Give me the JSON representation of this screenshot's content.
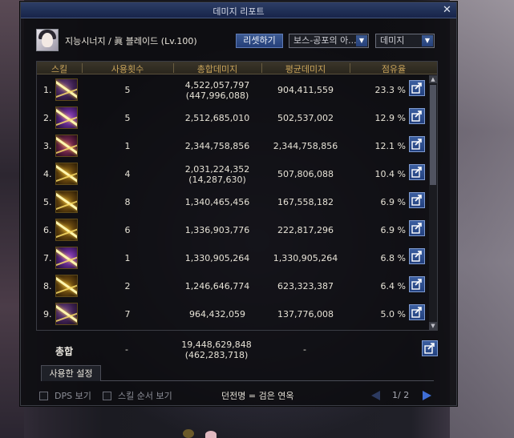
{
  "window": {
    "title": "데미지 리포트",
    "close_label": "✕"
  },
  "character": {
    "name": "지능시너지 / 眞 블레이드 (Lv.100)"
  },
  "controls": {
    "reset_label": "리셋하기",
    "boss_select": "보스-공포의 아...",
    "type_select": "데미지"
  },
  "table": {
    "headers": [
      "스킬",
      "사용횟수",
      "총합데미지",
      "평균데미지",
      "점유율"
    ],
    "rows": [
      {
        "rank": "1.",
        "count": "5",
        "total": "4,522,057,797",
        "total_sub": "(447,996,088)",
        "avg": "904,411,559",
        "share": "23.3 %"
      },
      {
        "rank": "2.",
        "count": "5",
        "total": "2,512,685,010",
        "total_sub": "",
        "avg": "502,537,002",
        "share": "12.9 %"
      },
      {
        "rank": "3.",
        "count": "1",
        "total": "2,344,758,856",
        "total_sub": "",
        "avg": "2,344,758,856",
        "share": "12.1 %"
      },
      {
        "rank": "4.",
        "count": "4",
        "total": "2,031,224,352",
        "total_sub": "(14,287,630)",
        "avg": "507,806,088",
        "share": "10.4 %"
      },
      {
        "rank": "5.",
        "count": "8",
        "total": "1,340,465,456",
        "total_sub": "",
        "avg": "167,558,182",
        "share": "6.9 %"
      },
      {
        "rank": "6.",
        "count": "6",
        "total": "1,336,903,776",
        "total_sub": "",
        "avg": "222,817,296",
        "share": "6.9 %"
      },
      {
        "rank": "7.",
        "count": "1",
        "total": "1,330,905,264",
        "total_sub": "",
        "avg": "1,330,905,264",
        "share": "6.8 %"
      },
      {
        "rank": "8.",
        "count": "2",
        "total": "1,246,646,774",
        "total_sub": "",
        "avg": "623,323,387",
        "share": "6.4 %"
      },
      {
        "rank": "9.",
        "count": "7",
        "total": "964,432,059",
        "total_sub": "",
        "avg": "137,776,008",
        "share": "5.0 %"
      }
    ]
  },
  "totals": {
    "label": "총합",
    "count": "-",
    "total": "19,448,629,848",
    "total_sub": "(462,283,718)",
    "avg": "-"
  },
  "settings_tab": "사용한 설정",
  "bottom": {
    "dps_label": "DPS 보기",
    "order_label": "스킬 순서 보기",
    "legend": "던전명 = 검은 연옥",
    "page": "1/ 2"
  }
}
